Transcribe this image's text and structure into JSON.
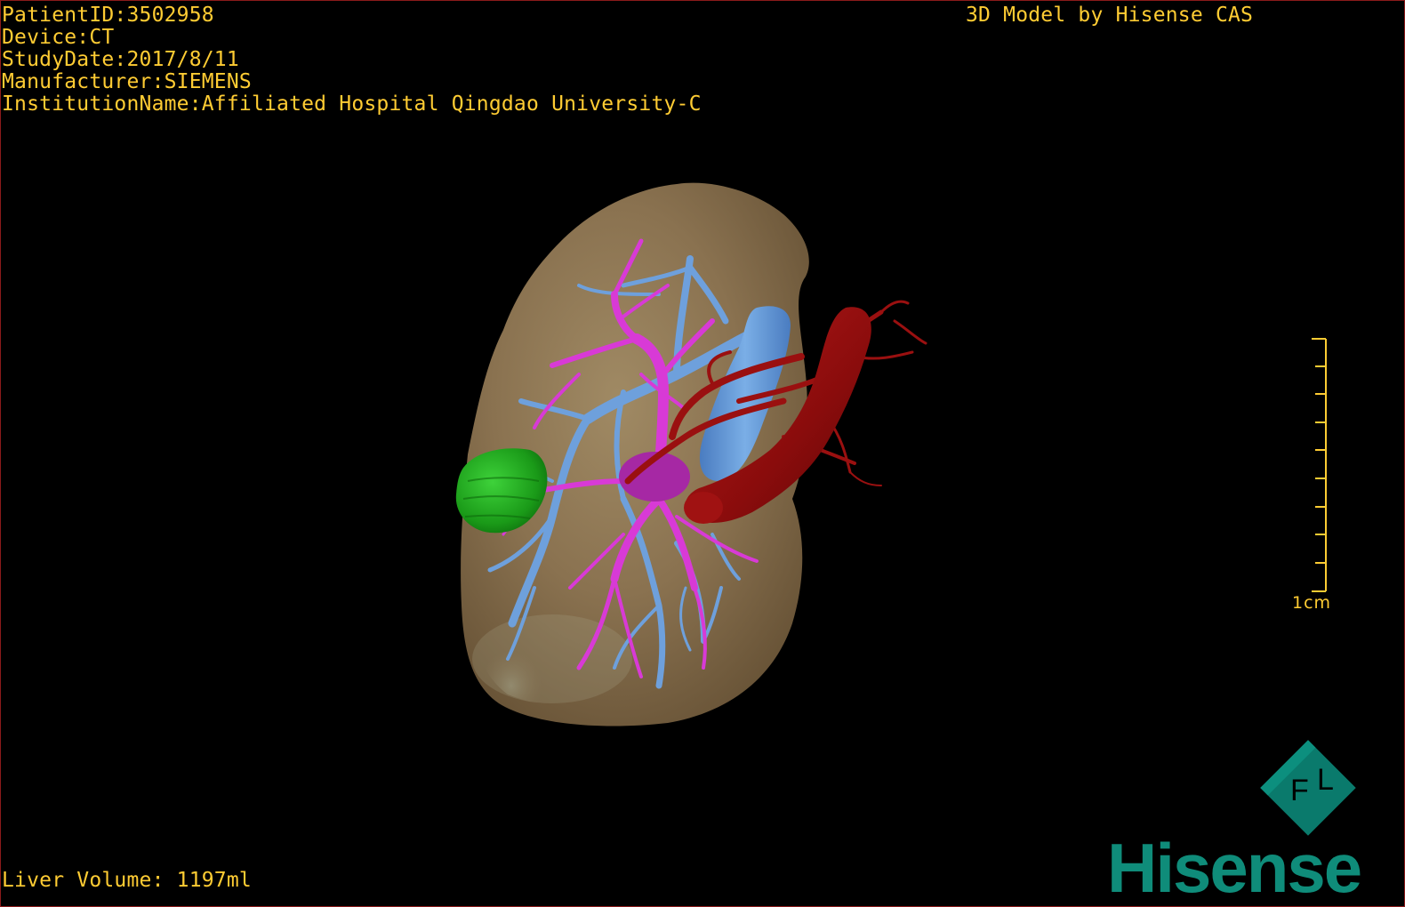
{
  "patient_info": {
    "patient_id": "PatientID:3502958",
    "device": "Device:CT",
    "study_date": "StudyDate:2017/8/11",
    "manufacturer": "Manufacturer:SIEMENS",
    "institution": "InstitutionName:Affiliated Hospital Qingdao University-C"
  },
  "model_credit": "3D Model by Hisense CAS",
  "liver_volume": "Liver Volume: 1197ml",
  "scale_bar": {
    "label": "1cm"
  },
  "orientation_cube": {
    "face_letters": [
      "F",
      "L"
    ]
  },
  "brand": {
    "logo_text": "Hisense"
  },
  "model_structures": [
    {
      "name": "liver",
      "color": "#8a7250"
    },
    {
      "name": "portal-vein",
      "color": "#d83ad6"
    },
    {
      "name": "hepatic-vein",
      "color": "#6ea0dc"
    },
    {
      "name": "artery",
      "color": "#9a1010"
    },
    {
      "name": "tumor",
      "color": "#22a020"
    }
  ],
  "colors": {
    "overlay_text": "#ffcc33",
    "brand": "#0f8c7a",
    "viewport_border": "#8b1a1a"
  }
}
